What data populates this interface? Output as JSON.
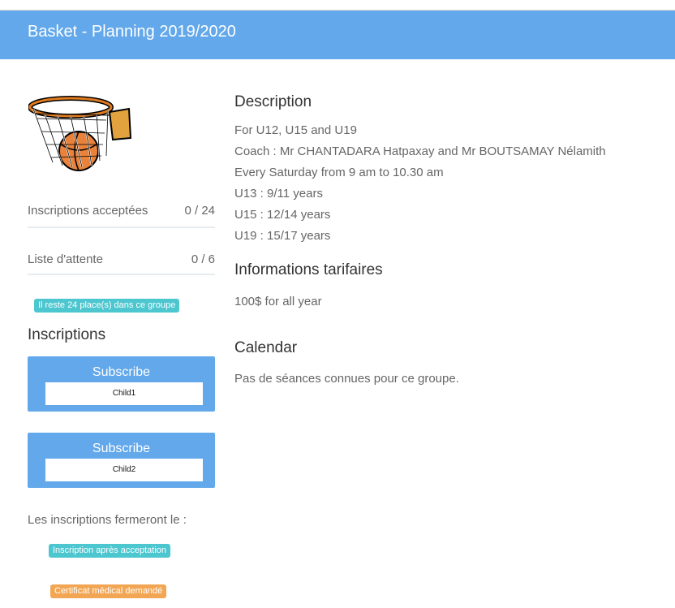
{
  "header": {
    "title": "Basket - Planning 2019/2020"
  },
  "sidebar": {
    "stats": [
      {
        "label": "Inscriptions acceptées",
        "value": "0 / 24"
      },
      {
        "label": "Liste d'attente",
        "value": "0 / 6"
      }
    ],
    "places_badge": "Il reste 24 place(s) dans ce groupe",
    "inscriptions_title": "Inscriptions",
    "subscriptions": [
      {
        "button": "Subscribe",
        "child": "Child1"
      },
      {
        "button": "Subscribe",
        "child": "Child2"
      }
    ],
    "closing_text": "Les inscriptions fermeront le :",
    "badges": [
      "Inscription après acceptation",
      "Certificat médical demandé"
    ]
  },
  "main": {
    "description_title": "Description",
    "description_lines": [
      "For U12, U15 and U19",
      "Coach : Mr CHANTADARA Hatpaxay and Mr BOUTSAMAY Nélamith",
      "Every Saturday from 9 am to 10.30 am",
      "U13 : 9/11 years",
      "U15 : 12/14 years",
      "U19 : 15/17 years"
    ],
    "pricing_title": "Informations tarifaires",
    "pricing_text": "100$ for all year",
    "calendar_title": "Calendar",
    "calendar_text": "Pas de séances connues pour ce groupe."
  },
  "colors": {
    "header": "#62a8ea",
    "teal_badge": "#4cc6cf",
    "orange_badge": "#f2a654"
  },
  "icons": {
    "logo": "basketball-hoop-icon"
  }
}
